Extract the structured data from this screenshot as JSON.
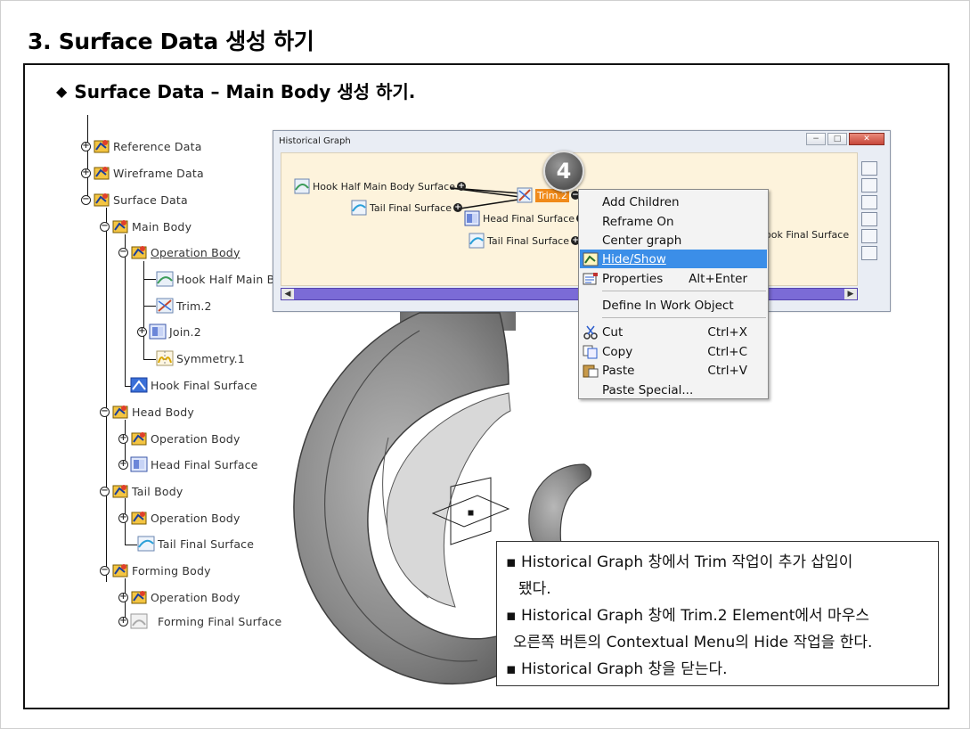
{
  "slide": {
    "title": "3. Surface Data 생성 하기",
    "subtitle": "Surface Data – Main Body 생성 하기.",
    "subtitle_bullet": "◆"
  },
  "tree": {
    "items": [
      {
        "label": "Reference Data"
      },
      {
        "label": "Wireframe Data"
      },
      {
        "label": "Surface Data"
      },
      {
        "label": "Main Body"
      },
      {
        "label": "Operation Body"
      },
      {
        "label": "Hook Half Main B"
      },
      {
        "label": "Trim.2"
      },
      {
        "label": "Join.2"
      },
      {
        "label": "Symmetry.1"
      },
      {
        "label": "Hook Final Surface"
      },
      {
        "label": "Head Body"
      },
      {
        "label": "Operation Body"
      },
      {
        "label": "Head Final Surface"
      },
      {
        "label": "Tail Body"
      },
      {
        "label": "Operation Body"
      },
      {
        "label": "Tail Final Surface"
      },
      {
        "label": "Forming Body"
      },
      {
        "label": "Operation Body"
      },
      {
        "label": "Forming Final Surface"
      }
    ]
  },
  "historical_graph": {
    "title": "Historical Graph",
    "nodes": {
      "hook_half": "Hook Half Main Body Surface",
      "tail_final_1": "Tail Final Surface",
      "trim": "Trim.2",
      "head_final": "Head Final Surface",
      "tail_final_2": "Tail Final Surface",
      "hook_final": "ook Final Surface"
    },
    "step_badge": "4"
  },
  "context_menu": {
    "items": [
      {
        "label": "Add Children",
        "accel": ""
      },
      {
        "label": "Reframe On",
        "accel": ""
      },
      {
        "label": "Center graph",
        "accel": ""
      },
      {
        "label": "Hide/Show",
        "accel": ""
      },
      {
        "label": "Properties",
        "accel": "Alt+Enter"
      },
      {
        "label": "Define In Work Object",
        "accel": ""
      },
      {
        "label": "Cut",
        "accel": "Ctrl+X"
      },
      {
        "label": "Copy",
        "accel": "Ctrl+C"
      },
      {
        "label": "Paste",
        "accel": "Ctrl+V"
      },
      {
        "label": "Paste Special...",
        "accel": ""
      }
    ],
    "highlighted": "Hide/Show"
  },
  "notes": {
    "bullet": "▪",
    "lines": [
      "Historical Graph 창에서 Trim 작업이 추가 삽입이",
      "됐다.",
      "Historical Graph 창에 Trim.2 Element에서 마우스",
      "오른쪽 버튼의 Contextual Menu의 Hide 작업을 한다.",
      "Historical Graph 창을 닫는다."
    ]
  },
  "colors": {
    "menu_highlight": "#3b8ee8",
    "graph_canvas": "#fdf3dc",
    "scrollbar": "#7b6bd6",
    "trim_node": "#f08a1a"
  }
}
